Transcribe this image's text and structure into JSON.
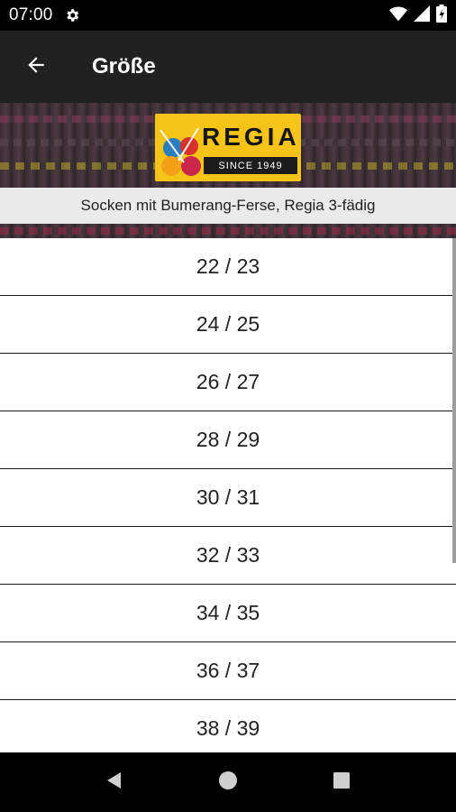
{
  "status_bar": {
    "time": "07:00",
    "battery_level": 0.95
  },
  "app_bar": {
    "title": "Größe",
    "back_icon": "arrow-back-icon"
  },
  "banner": {
    "logo_text": "REGIA",
    "logo_since": "SINCE 1949",
    "subtitle": "Socken mit Bumerang-Ferse, Regia 3-fädig"
  },
  "sizes": [
    "22 / 23",
    "24 / 25",
    "26 / 27",
    "28 / 29",
    "30 / 31",
    "32 / 33",
    "34 / 35",
    "36 / 37",
    "38 / 39"
  ],
  "navigation": {
    "back_icon": "triangle-back-icon",
    "home_icon": "circle-home-icon",
    "recents_icon": "square-recents-icon"
  },
  "colors": {
    "app_bar": "#212121",
    "logo": "#f6c416",
    "divider": "#1a1a1a"
  }
}
